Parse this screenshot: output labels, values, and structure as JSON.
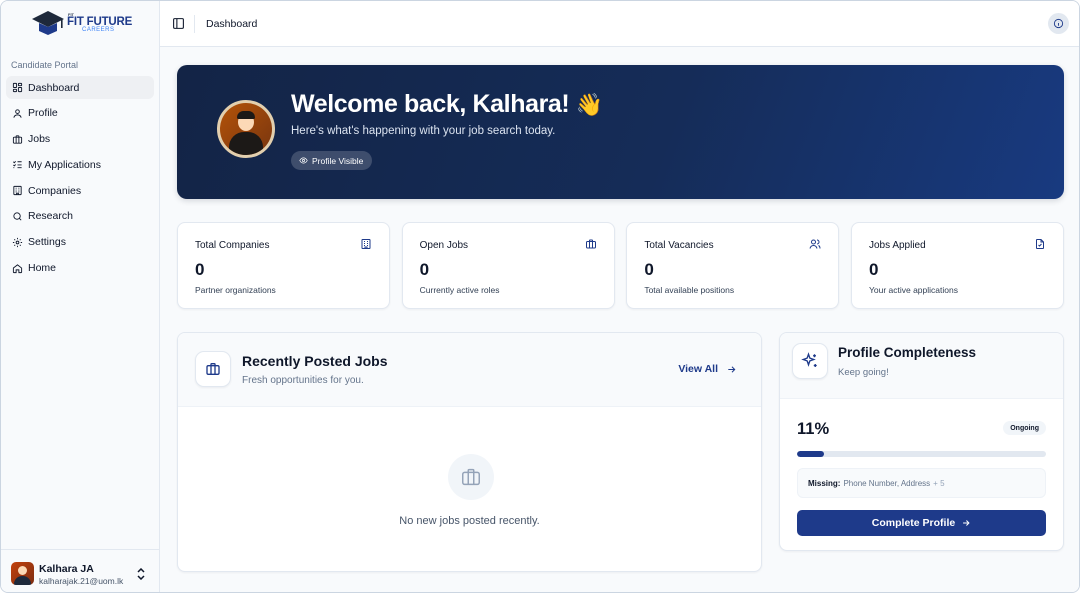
{
  "brand": {
    "small": "FIT",
    "title": "FIT FUTURE",
    "subtitle": "CAREERS"
  },
  "sidebar": {
    "section_label": "Candidate Portal",
    "items": [
      {
        "label": "Dashboard",
        "icon": "dashboard-icon",
        "active": true
      },
      {
        "label": "Profile",
        "icon": "user-icon",
        "active": false
      },
      {
        "label": "Jobs",
        "icon": "briefcase-icon",
        "active": false
      },
      {
        "label": "My Applications",
        "icon": "list-check-icon",
        "active": false
      },
      {
        "label": "Companies",
        "icon": "building-icon",
        "active": false
      },
      {
        "label": "Research",
        "icon": "search-icon",
        "active": false
      },
      {
        "label": "Settings",
        "icon": "gear-icon",
        "active": false
      },
      {
        "label": "Home",
        "icon": "home-icon",
        "active": false
      }
    ],
    "user": {
      "name": "Kalhara JA",
      "email": "kalharajak.21@uom.lk"
    }
  },
  "topbar": {
    "title": "Dashboard"
  },
  "hero": {
    "title": "Welcome back, Kalhara!",
    "emoji": "👋",
    "subtitle": "Here's what's happening with your job search today.",
    "badge": "Profile Visible"
  },
  "stats": [
    {
      "title": "Total Companies",
      "value": "0",
      "desc": "Partner organizations",
      "icon": "building-icon"
    },
    {
      "title": "Open Jobs",
      "value": "0",
      "desc": "Currently active roles",
      "icon": "briefcase-icon"
    },
    {
      "title": "Total Vacancies",
      "value": "0",
      "desc": "Total available positions",
      "icon": "users-icon"
    },
    {
      "title": "Jobs Applied",
      "value": "0",
      "desc": "Your active applications",
      "icon": "file-check-icon"
    }
  ],
  "recent_jobs": {
    "title": "Recently Posted Jobs",
    "subtitle": "Fresh opportunities for you.",
    "view_all": "View All",
    "empty": "No new jobs posted recently."
  },
  "profile_completeness": {
    "title": "Profile Completeness",
    "subtitle": "Keep going!",
    "percent_label": "11%",
    "progress": 0.11,
    "status": "Ongoing",
    "missing_label": "Missing:",
    "missing_items": "Phone Number, Address",
    "missing_more": "+ 5",
    "button": "Complete Profile"
  },
  "colors": {
    "primary": "#1e3a8a",
    "hero_start": "#132446",
    "hero_end": "#183a80"
  }
}
